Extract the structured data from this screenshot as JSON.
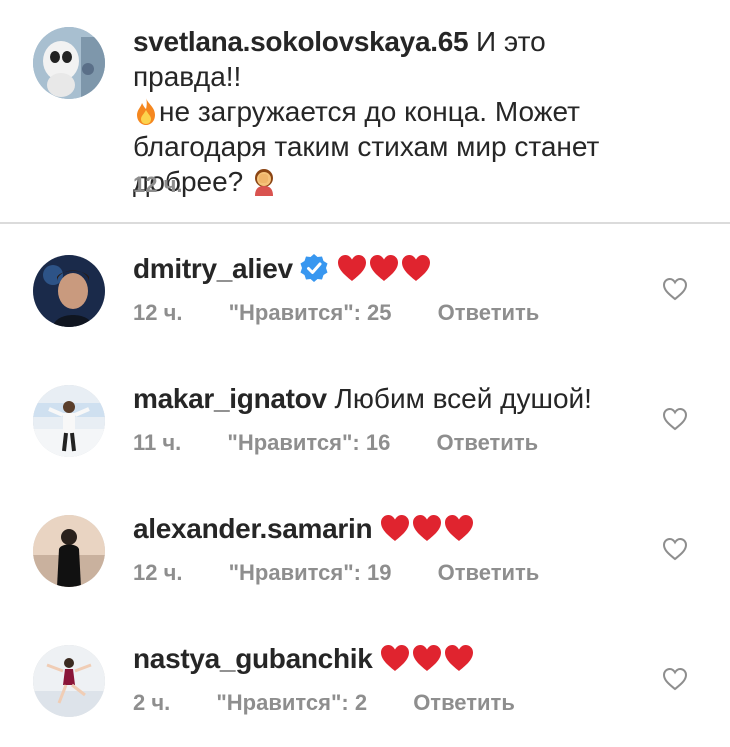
{
  "comments": [
    {
      "username": "svetlana.sokolovskaya.65",
      "text_part1": " И это правда!!",
      "text_part2": "не загружается до конца. Может благодаря таким стихам мир станет добрее?",
      "time": "12 ч.",
      "emojis": [
        "fire",
        "facepalm-woman"
      ]
    },
    {
      "username": "dmitry_aliev",
      "verified": true,
      "emojis": [
        "red-heart",
        "red-heart",
        "red-heart"
      ],
      "time": "12 ч.",
      "likes": "\"Нравится\": 25",
      "reply": "Ответить"
    },
    {
      "username": "makar_ignatov",
      "text": " Любим всей душой!",
      "time": "11 ч.",
      "likes": "\"Нравится\": 16",
      "reply": "Ответить"
    },
    {
      "username": "alexander.samarin",
      "emojis": [
        "red-heart",
        "red-heart",
        "red-heart"
      ],
      "time": "12 ч.",
      "likes": "\"Нравится\": 19",
      "reply": "Ответить"
    },
    {
      "username": "nastya_gubanchik",
      "emojis": [
        "red-heart",
        "red-heart",
        "red-heart"
      ],
      "time": "2 ч.",
      "likes": "\"Нравится\": 2",
      "reply": "Ответить"
    }
  ],
  "colors": {
    "heart": "#e0242f",
    "verified": "#3897f0",
    "meta": "#8e8e8e"
  }
}
